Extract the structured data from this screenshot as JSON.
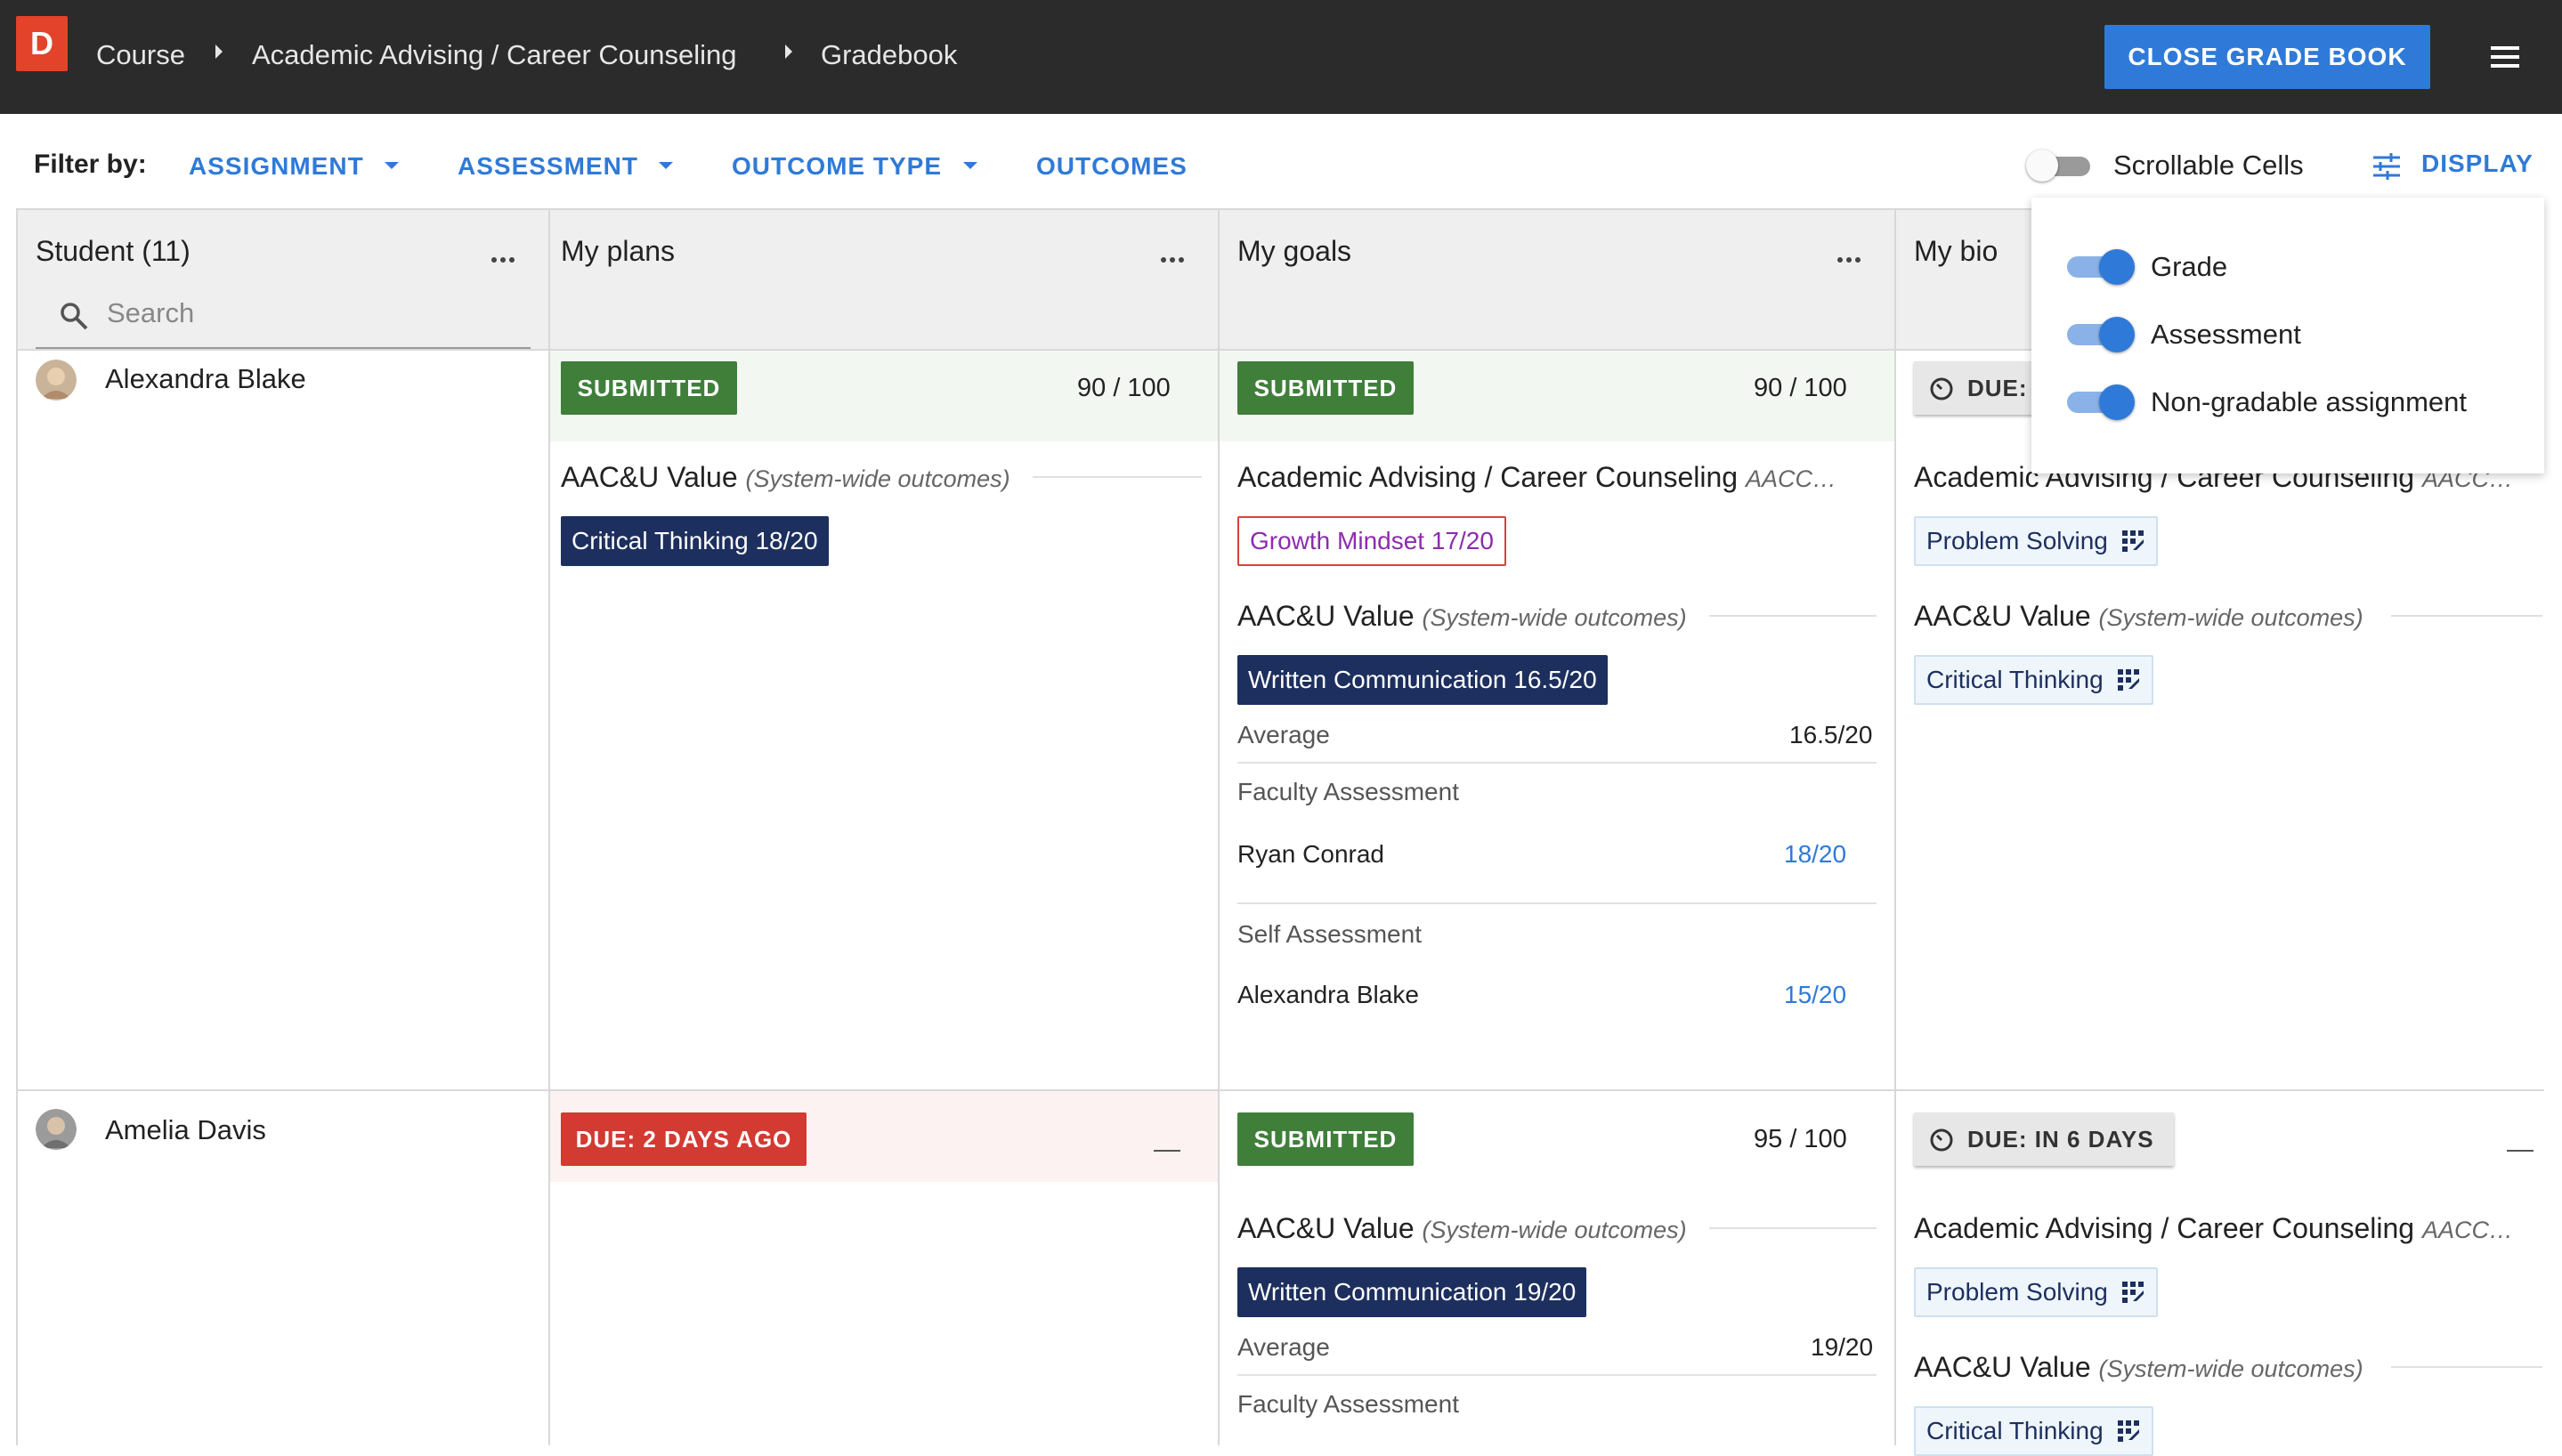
{
  "app": {
    "logo_letter": "D",
    "breadcrumb": [
      "Course",
      "Academic Advising / Career Counseling",
      "Gradebook"
    ],
    "close_button": "CLOSE GRADE BOOK"
  },
  "filters": {
    "label": "Filter by:",
    "items": [
      "ASSIGNMENT",
      "ASSESSMENT",
      "OUTCOME TYPE",
      "OUTCOMES"
    ],
    "scrollable_cells_label": "Scrollable Cells",
    "scrollable_cells_on": false,
    "display_label": "DISPLAY"
  },
  "display_popover": {
    "options": [
      {
        "label": "Grade",
        "on": true
      },
      {
        "label": "Assessment",
        "on": true
      },
      {
        "label": "Non-gradable assignment",
        "on": true
      }
    ]
  },
  "columns": {
    "student_header": "Student (11)",
    "search_placeholder": "Search",
    "assignments": [
      "My plans",
      "My goals",
      "My bio"
    ]
  },
  "rows": [
    {
      "student": "Alexandra Blake",
      "plans": {
        "status": "SUBMITTED",
        "score": "90 / 100",
        "group_title": "AAC&U Value",
        "group_scope": "(System-wide outcomes)",
        "chip": "Critical Thinking 18/20"
      },
      "goals": {
        "status": "SUBMITTED",
        "score": "90 / 100",
        "group1_title": "Academic Advising / Career Counseling",
        "group1_scope": "AACC…",
        "chip1": "Growth Mindset 17/20",
        "group2_title": "AAC&U Value",
        "group2_scope": "(System-wide outcomes)",
        "chip2": "Written Communication 16.5/20",
        "average_label": "Average",
        "average_value": "16.5/20",
        "faculty_label": "Faculty Assessment",
        "faculty_name": "Ryan Conrad",
        "faculty_score": "18/20",
        "self_label": "Self Assessment",
        "self_name": "Alexandra Blake",
        "self_score": "15/20"
      },
      "bio": {
        "status": "DUE:",
        "group1_title": "Academic Advising / Career Counseling",
        "group1_scope": "AACC…",
        "chip1": "Problem Solving",
        "group2_title": "AAC&U Value",
        "group2_scope": "(System-wide outcomes)",
        "chip2": "Critical Thinking"
      }
    },
    {
      "student": "Amelia Davis",
      "plans": {
        "status": "DUE: 2 DAYS AGO",
        "score": "—"
      },
      "goals": {
        "status": "SUBMITTED",
        "score": "95 / 100",
        "group_title": "AAC&U Value",
        "group_scope": "(System-wide outcomes)",
        "chip": "Written Communication 19/20",
        "average_label": "Average",
        "average_value": "19/20",
        "faculty_label": "Faculty Assessment"
      },
      "bio": {
        "status": "DUE: IN 6 DAYS",
        "score": "—",
        "group1_title": "Academic Advising / Career Counseling",
        "group1_scope": "AACC…",
        "chip1": "Problem Solving",
        "group2_title": "AAC&U Value",
        "group2_scope": "(System-wide outcomes)",
        "chip2": "Critical Thinking"
      }
    }
  ],
  "colors": {
    "accent": "#2f7ad8",
    "submitted": "#3f7f3a",
    "overdue": "#d23a32",
    "outcome_chip": "#1d2f5e",
    "topbar": "#2b2b2b"
  }
}
